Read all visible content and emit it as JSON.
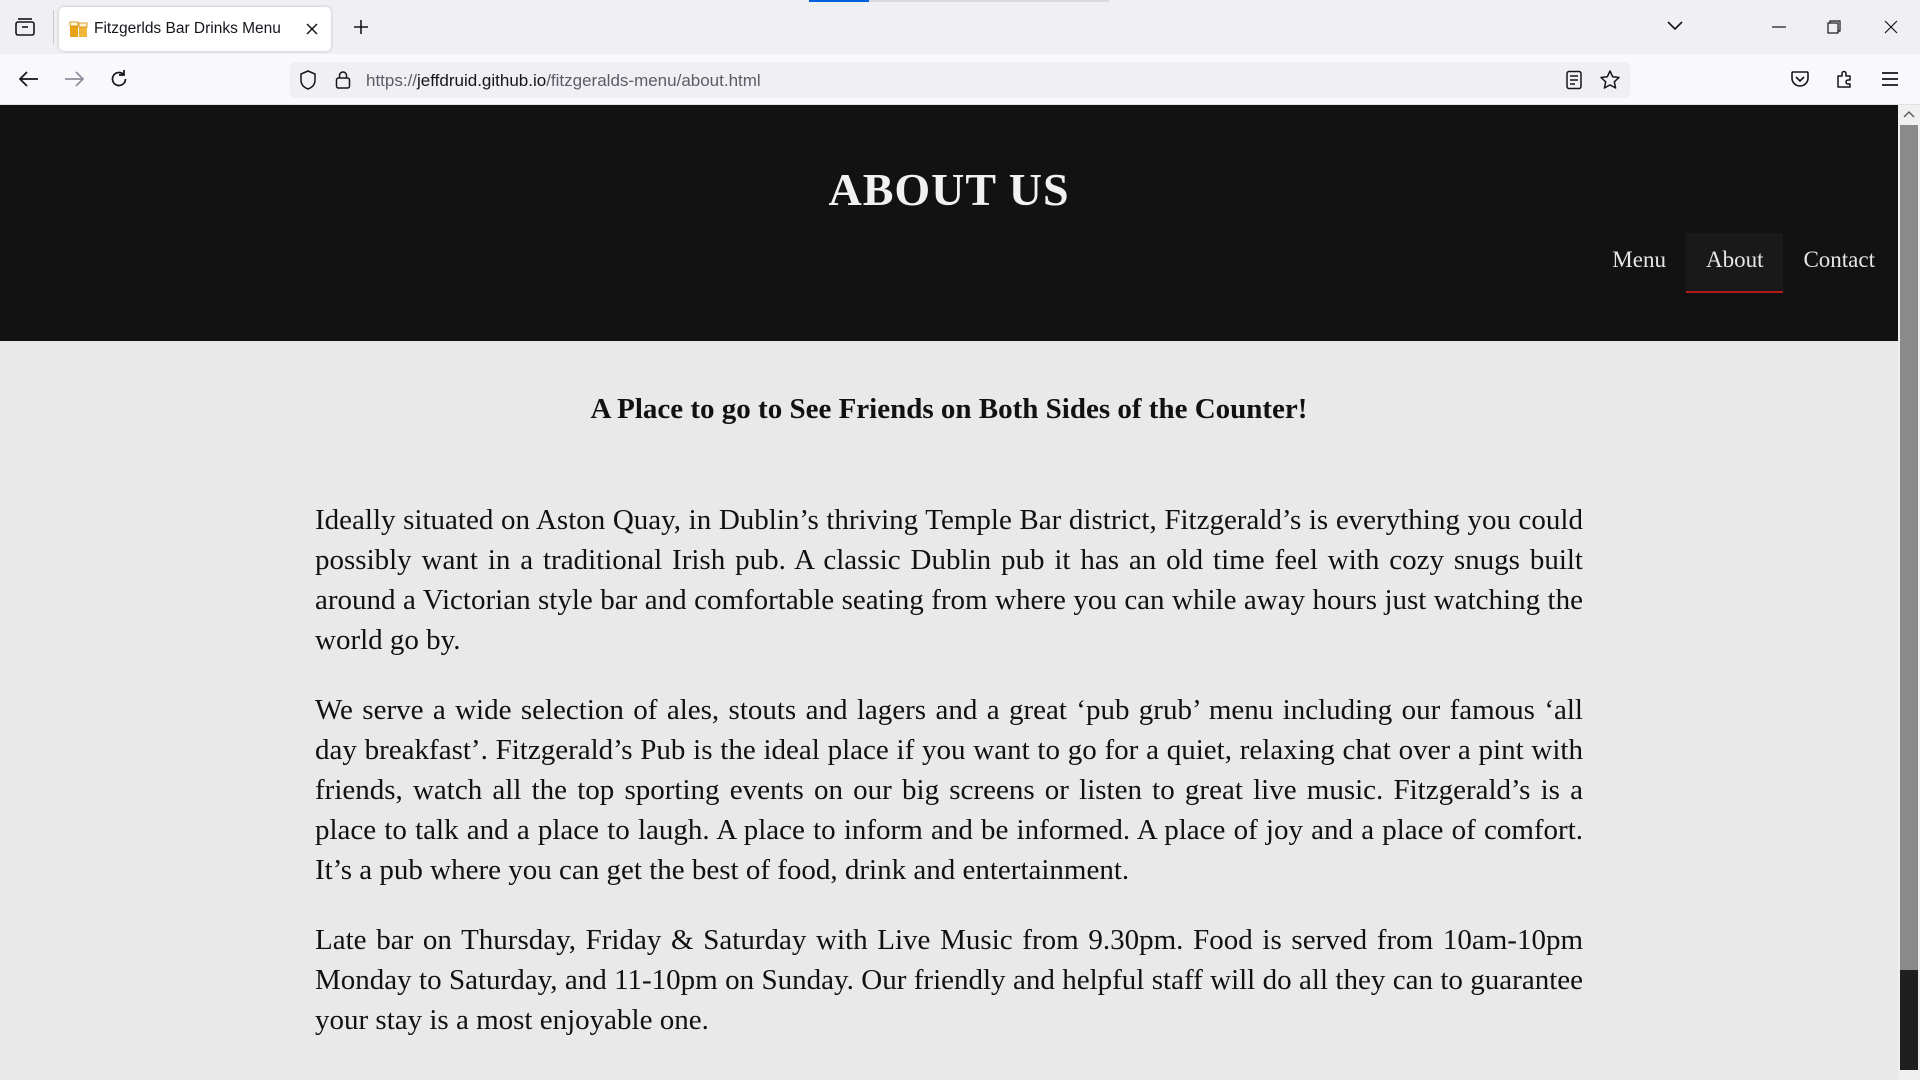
{
  "browser": {
    "tab": {
      "title": "Fitzgerlds Bar Drinks Menu",
      "favicon": "beer-favicon-icon"
    },
    "url": {
      "scheme": "https://",
      "host": "jeffdruid.github.io",
      "path": "/fitzgeralds-menu/about.html"
    },
    "icons": {
      "tab_list": "tab-list-icon",
      "new_tab": "plus-icon",
      "tabs_overflow": "chevron-down-icon",
      "back": "back-arrow-icon",
      "forward": "forward-arrow-icon",
      "reload": "reload-icon",
      "shield": "shield-icon",
      "lock": "lock-icon",
      "reader": "reader-view-icon",
      "bookmark": "star-icon",
      "pocket": "pocket-icon",
      "extensions": "puzzle-icon",
      "menu": "hamburger-menu-icon"
    }
  },
  "site": {
    "title": "ABOUT US",
    "nav": [
      {
        "label": "Menu",
        "active": false
      },
      {
        "label": "About",
        "active": true
      },
      {
        "label": "Contact",
        "active": false
      }
    ],
    "tagline": "A Place to go to See Friends on Both Sides of the Counter!",
    "paragraphs": [
      "Ideally situated on Aston Quay, in Dublin’s thriving Temple Bar district, Fitzgerald’s is everything you could possibly want in a traditional Irish pub. A classic Dublin pub it has an old time feel with cozy snugs built around a Victorian style bar and comfortable seating from where you can while away hours just watching the world go by.",
      "We serve a wide selection of ales, stouts and lagers and a great ‘pub grub’ menu including our famous ‘all day breakfast’. Fitzgerald’s Pub is the ideal place if you want to go for a quiet, relaxing chat over a pint with friends, watch all the top sporting events on our big screens or listen to great live music. Fitzgerald’s is a place to talk and a place to laugh. A place to inform and be informed. A place of joy and a place of comfort. It’s a pub where you can get the best of food, drink and entertainment.",
      "Late bar on Thursday, Friday & Saturday with Live Music from 9.30pm. Food is served from 10am-10pm Monday to Saturday, and 11-10pm on Sunday. Our friendly and helpful staff will do all they can to guarantee your stay is a most enjoyable one."
    ],
    "colors": {
      "header_bg": "#121212",
      "page_bg": "#e9e9ea",
      "active_underline": "#b31b1b"
    }
  }
}
